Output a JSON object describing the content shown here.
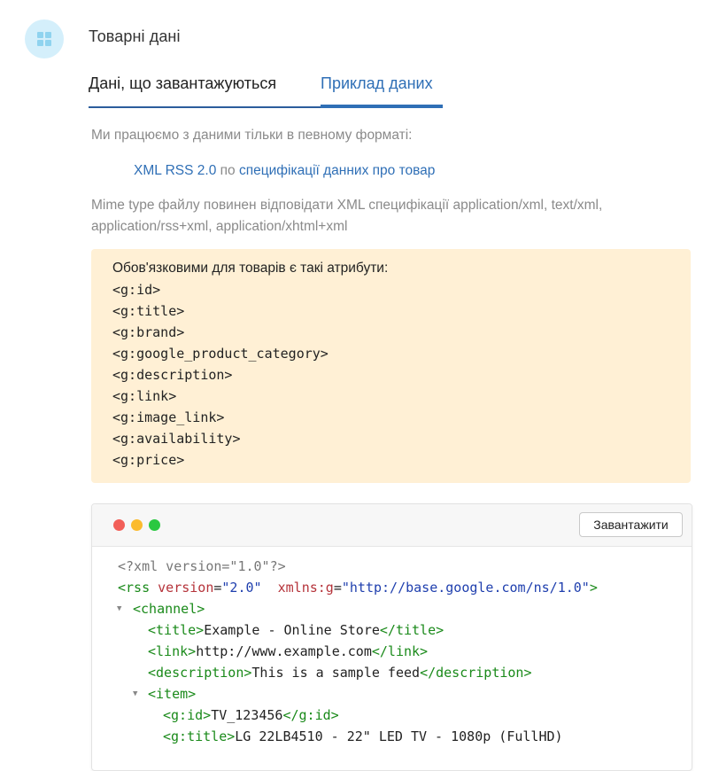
{
  "header": {
    "title": "Товарні дані",
    "icon": "grid-icon",
    "icon_bg": "#d4effb",
    "icon_color": "#8fd3ef"
  },
  "tabs": [
    {
      "label": "Дані, що завантажуються",
      "active": false
    },
    {
      "label": "Приклад даних",
      "active": true
    }
  ],
  "intro": {
    "text": "Ми працюємо з даними тільки в певному форматі:",
    "format_link": "XML RSS 2.0",
    "connector": " по ",
    "spec_link": "специфікації данних про товар",
    "mime": "Mime type файлу повинен відповідати XML специфікації application/xml, text/xml, application/rss+xml, application/xhtml+xml"
  },
  "required": {
    "heading": "Обов'язковими для товарів є такі атрибути:",
    "attributes": [
      "<g:id>",
      "<g:title>",
      "<g:brand>",
      "<g:google_product_category>",
      "<g:description>",
      "<g:link>",
      "<g:image_link>",
      "<g:availability>",
      "<g:price>"
    ]
  },
  "code": {
    "download_label": "Завантажити",
    "window_dots": [
      "#f25f58",
      "#fbbb2d",
      "#2ac840"
    ],
    "lines": {
      "decl": "<?xml version=\"1.0\"?>",
      "rss_open": "<rss",
      "rss_attr1": "version",
      "rss_val1": "\"2.0\"",
      "rss_attr2": "xmlns:g",
      "rss_val2": "\"http://base.google.com/ns/1.0\"",
      "rss_close": ">",
      "channel": "<channel>",
      "title_open": "<title>",
      "title_text": "Example - Online Store",
      "title_close": "</title>",
      "link_open": "<link>",
      "link_text": "http://www.example.com",
      "link_close": "</link>",
      "desc_open": "<description>",
      "desc_text": "This is a sample feed",
      "desc_close": "</description>",
      "item": "<item>",
      "gid_open": "<g:id>",
      "gid_text": "TV_123456",
      "gid_close": "</g:id>",
      "gtitle_open": "<g:title>",
      "gtitle_text": "LG 22LB4510 - 22\" LED TV - 1080p (FullHD)",
      "toggle": "▼"
    }
  }
}
